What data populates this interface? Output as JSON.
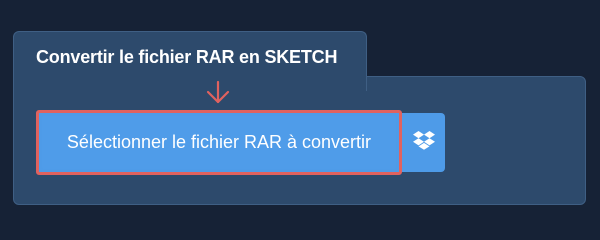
{
  "converter": {
    "tab_title": "Convertir le fichier RAR en SKETCH",
    "select_button_label": "Sélectionner le fichier RAR à convertir",
    "icons": {
      "hint_arrow": "arrow-down-icon",
      "dropbox": "dropbox-icon"
    }
  },
  "colors": {
    "page_background": "#162236",
    "panel_background": "#2d4a6c",
    "button_blue": "#4e9be8",
    "highlight_red": "#e0625f",
    "text_white": "#ffffff"
  }
}
